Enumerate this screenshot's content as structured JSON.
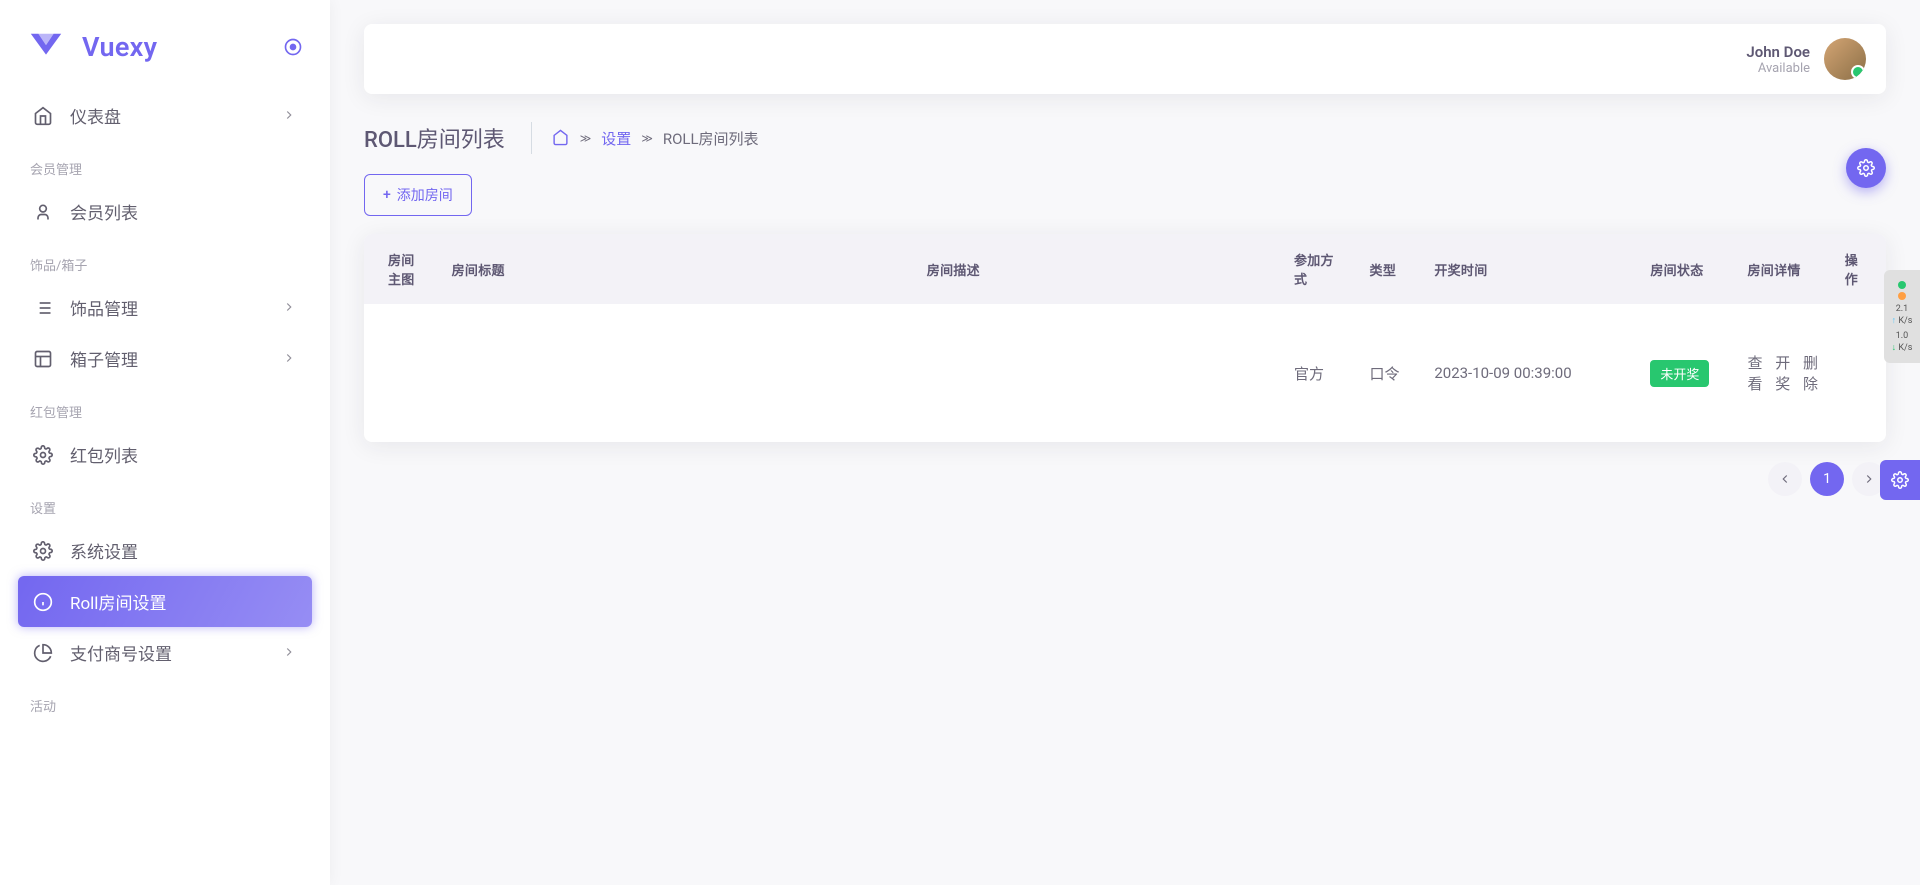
{
  "brand": {
    "name": "Vuexy"
  },
  "user": {
    "name": "John Doe",
    "status": "Available"
  },
  "sidebar": {
    "dashboard": "仪表盘",
    "sections": {
      "member": "会员管理",
      "ornament": "饰品/箱子",
      "redpack": "红包管理",
      "settings": "设置",
      "activity": "活动"
    },
    "items": {
      "member_list": "会员列表",
      "ornament_mgmt": "饰品管理",
      "box_mgmt": "箱子管理",
      "redpack_list": "红包列表",
      "system_settings": "系统设置",
      "roll_room_settings": "Roll房间设置",
      "payment_settings": "支付商号设置"
    }
  },
  "page": {
    "title": "ROLL房间列表",
    "breadcrumb": {
      "settings": "设置",
      "current": "ROLL房间列表"
    },
    "add_button": "添加房间"
  },
  "table": {
    "headers": {
      "image": "房间主图",
      "title": "房间标题",
      "desc": "房间描述",
      "method": "参加方式",
      "type": "类型",
      "open_time": "开奖时间",
      "status": "房间状态",
      "details": "房间详情",
      "actions": "操作"
    },
    "rows": [
      {
        "method": "官方",
        "type": "口令",
        "open_time": "2023-10-09 00:39:00",
        "status": "未开奖"
      }
    ],
    "action_labels": {
      "view": "查看",
      "draw": "开奖",
      "delete": "删除"
    }
  },
  "pagination": {
    "current": "1"
  },
  "perf": {
    "up": "2.1",
    "up_unit": "K/s",
    "down": "1.0",
    "down_unit": "K/s"
  }
}
